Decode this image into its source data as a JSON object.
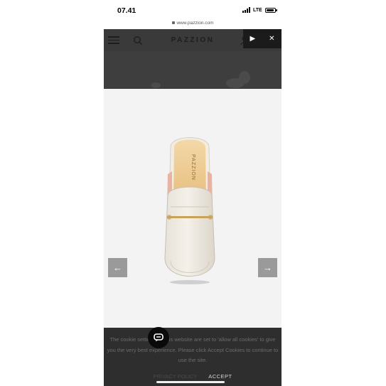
{
  "status_bar": {
    "time": "07.41",
    "network": "LTE",
    "battery_level": 0.9
  },
  "browser": {
    "url": "www.pazzion.com"
  },
  "header": {
    "logo": "PAZZION",
    "icons": [
      "hamburger-menu-icon",
      "search-icon",
      "account-icon"
    ]
  },
  "video_controls": {
    "play_icon": "▶",
    "close_icon": "✕"
  },
  "product": {
    "image_name": "white loafer mule with gold bit",
    "insole_brand": "PAZZION"
  },
  "carousel": {
    "prev_icon": "←",
    "next_icon": "→"
  },
  "cookie_banner": {
    "message": "The cookie settings on this website are set to 'allow all cookies' to give you the very best experience. Please click Accept Cookies to continue to use the site.",
    "policy_link": "PRIVACY POLICY",
    "accept_label": "ACCEPT"
  },
  "chat": {
    "icon": "chat-icon"
  },
  "colors": {
    "header_bg": "#3a3a3a",
    "cookie_bg": "#2e2e2e",
    "arrow_bg": "#9a9a9a",
    "chat_bg": "#0a0a0a"
  }
}
